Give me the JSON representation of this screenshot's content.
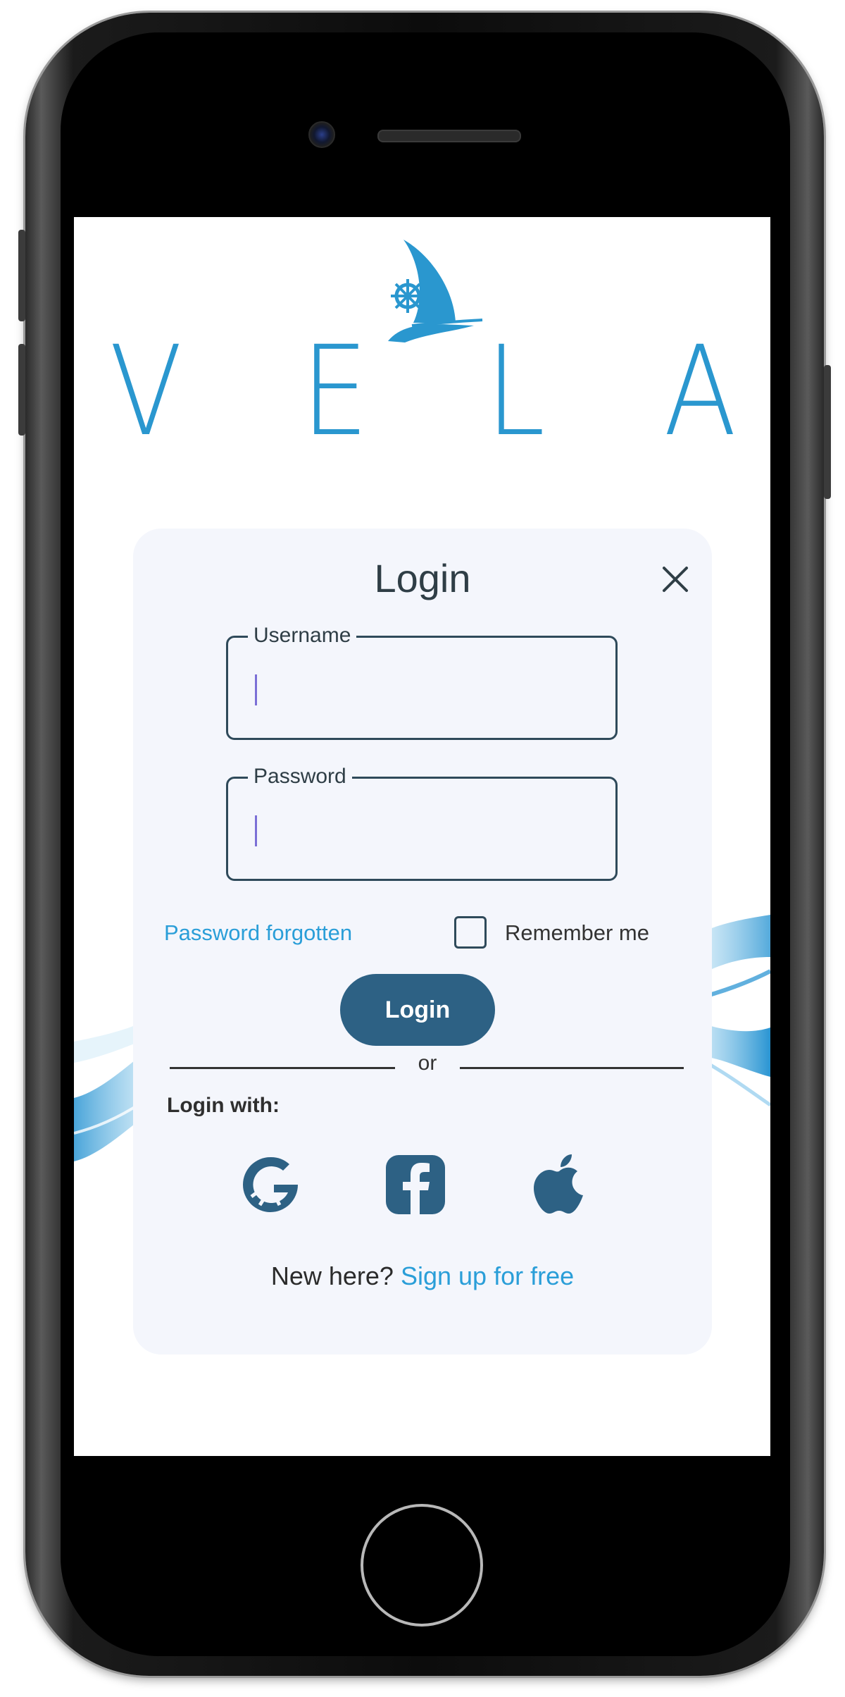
{
  "brand": {
    "letters": [
      "V",
      "E",
      "L",
      "A"
    ],
    "logo_icon": "sailboat-helm-icon",
    "accent_color": "#2a97cf"
  },
  "login_card": {
    "title": "Login",
    "close_icon": "close-icon",
    "username": {
      "label": "Username",
      "value": ""
    },
    "password": {
      "label": "Password",
      "value": ""
    },
    "forgot_link": "Password forgotten",
    "remember_label": "Remember me",
    "remember_checked": false,
    "submit_label": "Login",
    "divider_text": "or",
    "login_with_label": "Login with:",
    "social_providers": [
      {
        "name": "Google",
        "icon": "google-icon"
      },
      {
        "name": "Facebook",
        "icon": "facebook-icon"
      },
      {
        "name": "Apple",
        "icon": "apple-icon"
      }
    ],
    "signup_prompt": "New here?",
    "signup_link": "Sign up for free",
    "button_color": "#2d6184",
    "link_color": "#2a9ed8"
  }
}
